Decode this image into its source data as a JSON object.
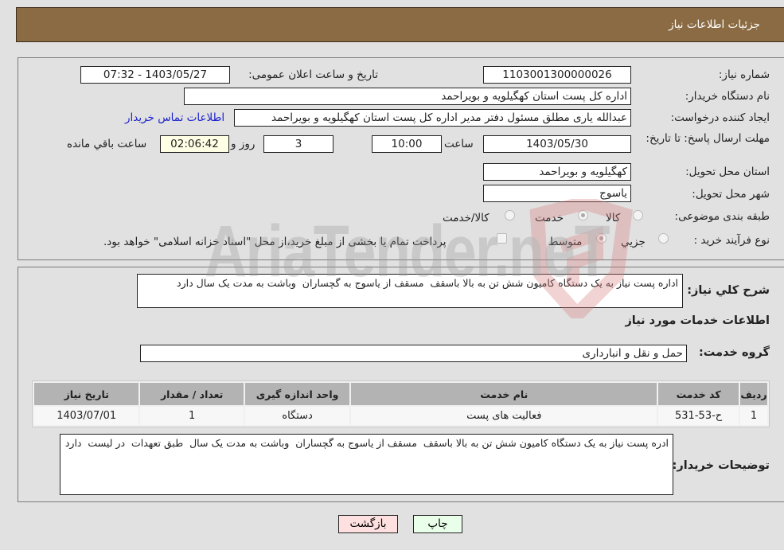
{
  "header": {
    "title": "جزئیات اطلاعات نیاز"
  },
  "form": {
    "need_number_label": "شماره نیاز:",
    "need_number": "1103001300000026",
    "announce_label": "تاریخ و ساعت اعلان عمومی:",
    "announce_value": "1403/05/27 - 07:32",
    "buyer_org_label": "نام دستگاه خریدار:",
    "buyer_org": "اداره کل پست استان کهگیلویه و بویراحمد",
    "creator_label": "ایجاد کننده درخواست:",
    "creator": "عبدالله یاری مطلق مسئول دفتر مدیر اداره کل پست استان کهگیلویه و بویراحمد",
    "contact_link": "اطلاعات تماس خریدار",
    "deadline_label": "مهلت ارسال پاسخ: تا تاریخ:",
    "deadline_date": "1403/05/30",
    "time_label": "ساعت",
    "deadline_time": "10:00",
    "days": "3",
    "days_label": "روز و",
    "remaining": "02:06:42",
    "remaining_label": "ساعت باقي مانده",
    "province_label": "استان محل تحویل:",
    "province": "کهگیلویه و بویراحمد",
    "city_label": "شهر محل تحویل:",
    "city": "یاسوج",
    "category_label": "طبقه بندی موضوعی:",
    "category_options": [
      "کالا",
      "خدمت",
      "کالا/خدمت"
    ],
    "category_selected": "خدمت",
    "process_label": "نوع فرآیند خرید :",
    "process_options": [
      "جزيي",
      "متوسط"
    ],
    "process_selected": "متوسط",
    "payment_note": "پرداخت تمام یا بخشی از مبلغ خرید،از محل \"اسناد خزانه اسلامی\" خواهد بود."
  },
  "details": {
    "summary_label": "شرح كلي نياز:",
    "summary": "اداره پست نیاز به یک دستگاه کامیون شش تن به بالا باسقف  مسقف از یاسوج به گچساران  وباشت به مدت یک سال دارد",
    "services_heading": "اطلاعات خدمات مورد نیاز",
    "service_group_label": "گروه خدمت:",
    "service_group": "حمل و نقل و انبارداری",
    "table": {
      "columns": [
        "ردیف",
        "کد خدمت",
        "نام خدمت",
        "واحد اندازه گیری",
        "تعداد / مقدار",
        "تاریخ نیاز"
      ],
      "rows": [
        [
          "1",
          "ح-53-531",
          "فعالیت های پست",
          "دستگاه",
          "1",
          "1403/07/01"
        ]
      ]
    },
    "buyer_notes_label": "توضیحات خریدار:",
    "buyer_notes": "ادره پست نیاز به یک دستگاه کامیون شش تن به بالا باسقف  مسقف از یاسوج به گچساران  وباشت به مدت یک سال  طبق تعهدات  در لیست  دارد"
  },
  "buttons": {
    "print": "چاپ",
    "back": "بازگشت"
  },
  "watermark": {
    "text": "AriaTender.neT"
  }
}
